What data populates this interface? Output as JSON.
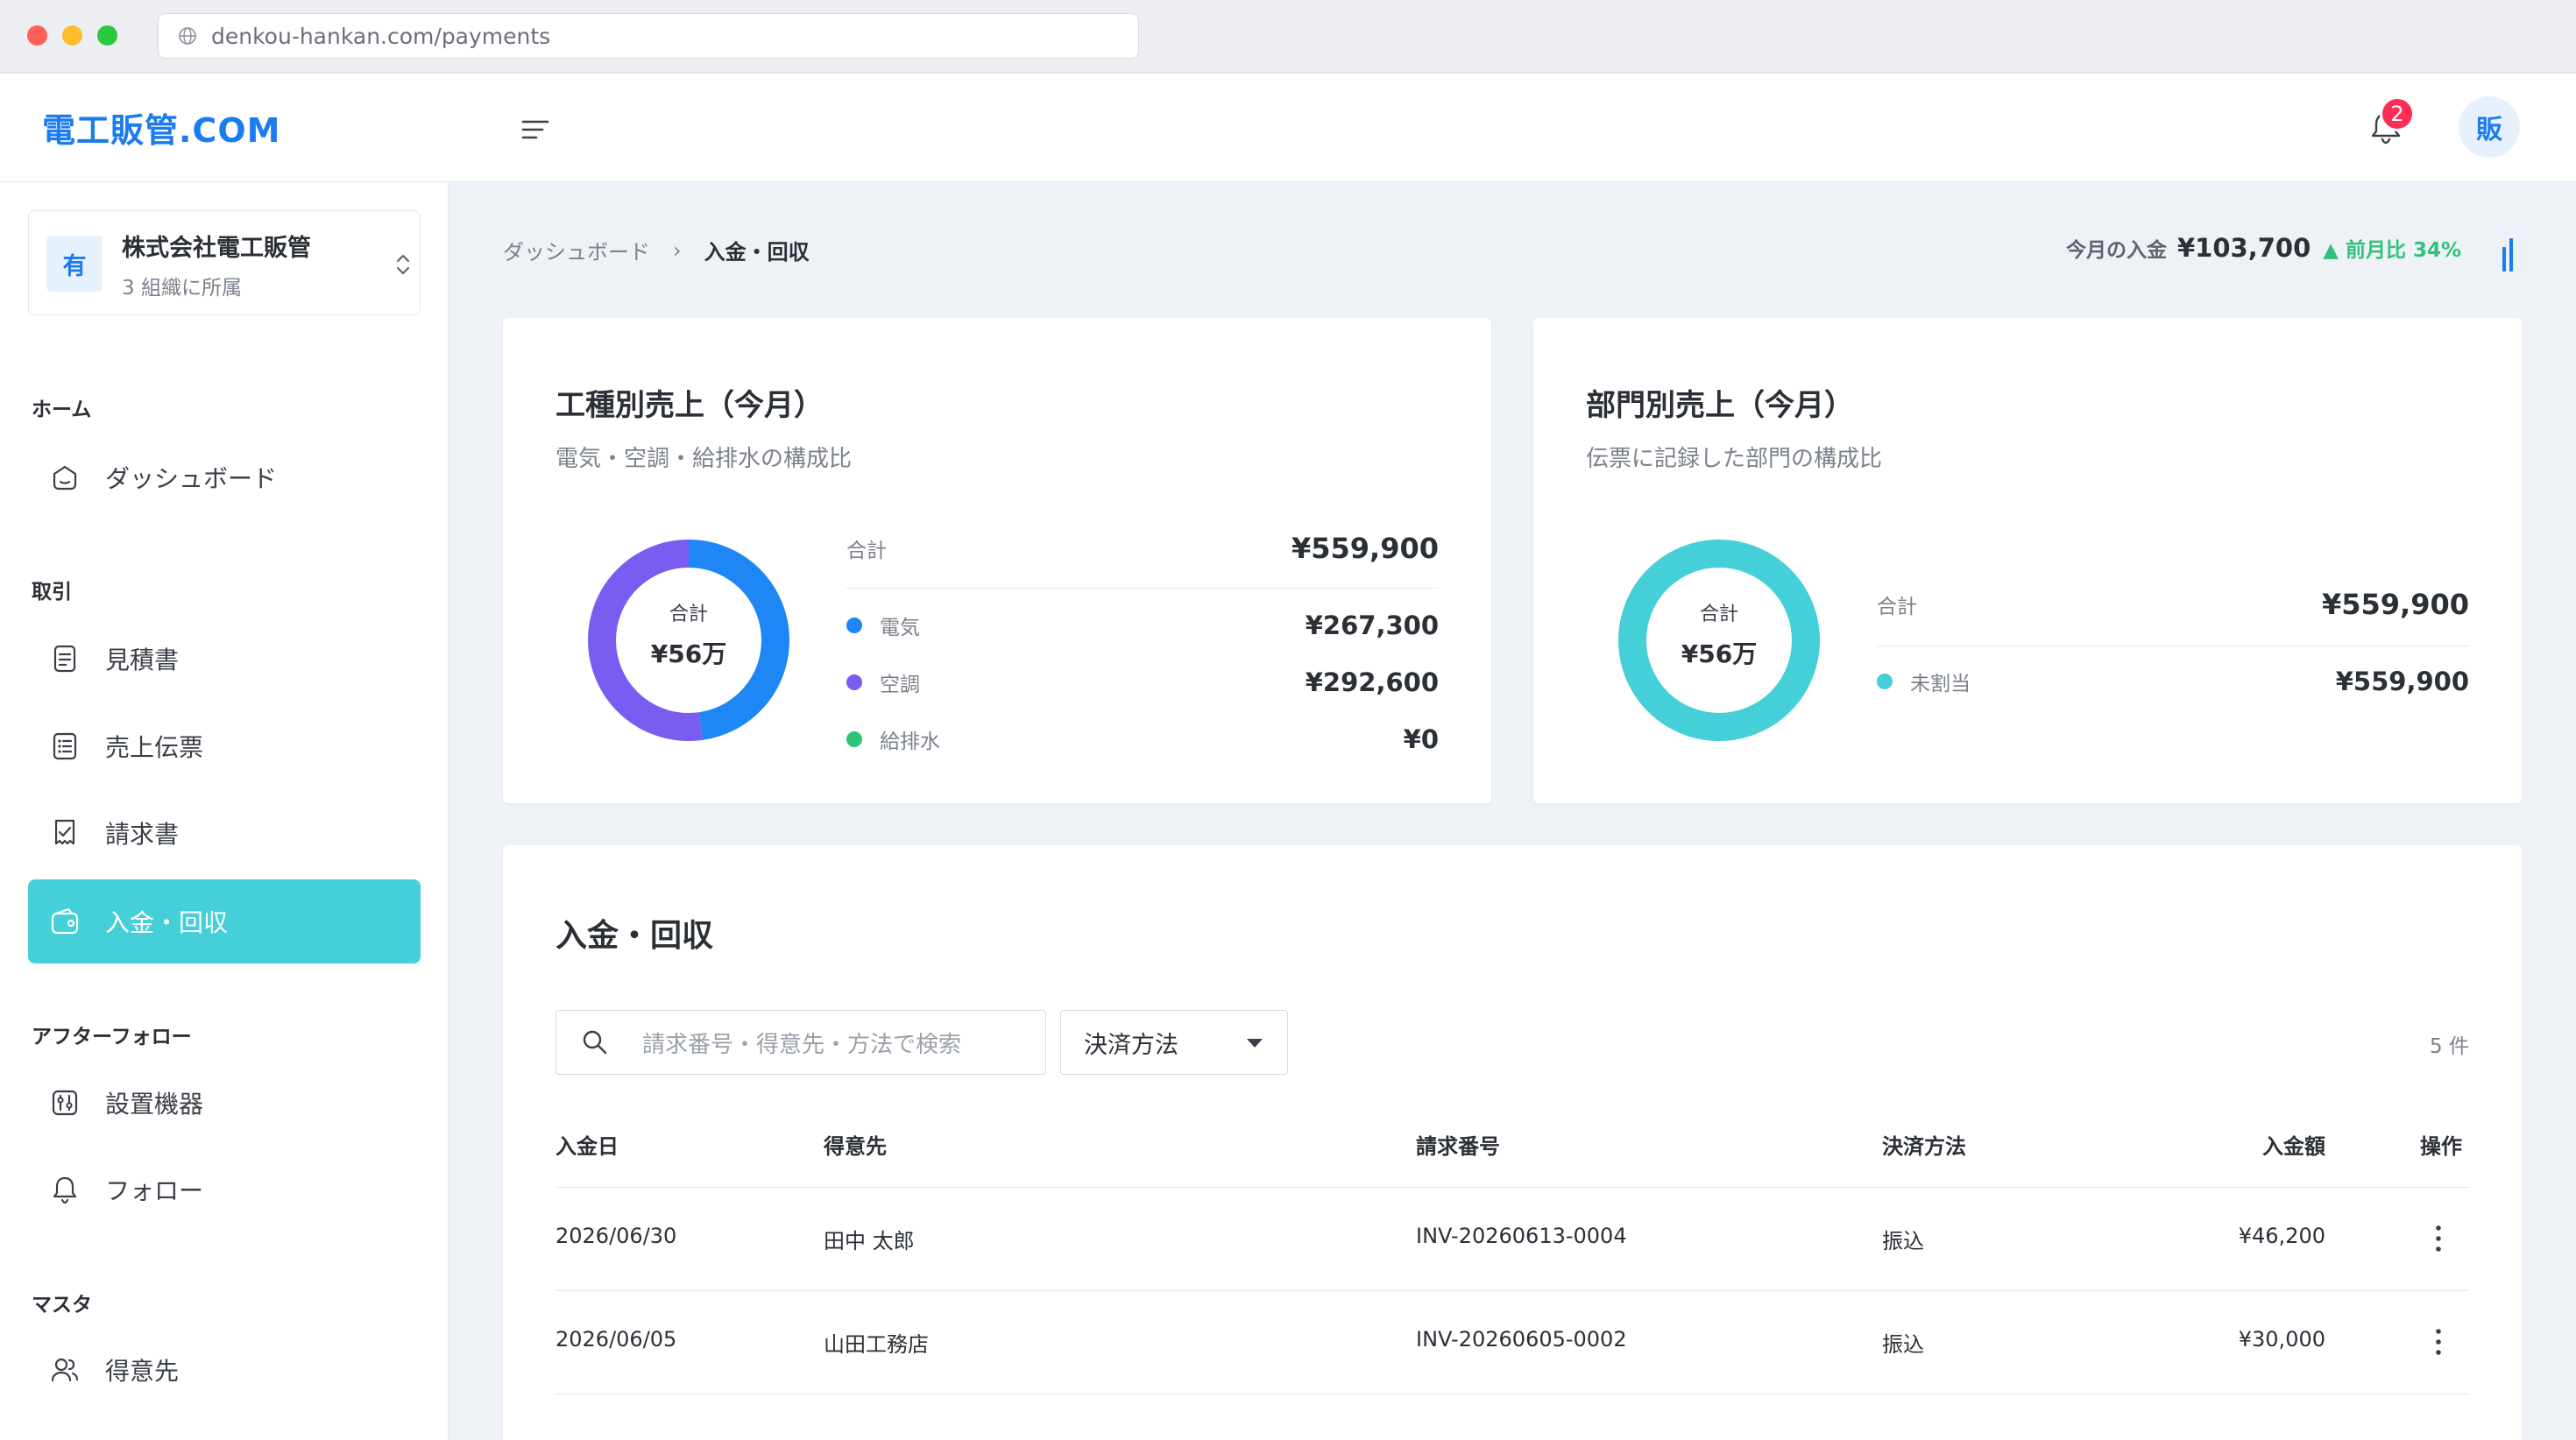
{
  "browser": {
    "url": "denkou-hankan.com/payments"
  },
  "header": {
    "logo": "電工販管.COM",
    "notification_count": "2",
    "avatar_initial": "販"
  },
  "sidebar": {
    "org": {
      "icon_initial": "有",
      "name": "株式会社電工販管",
      "sub": "3 組織に所属"
    },
    "sections": [
      {
        "label": "ホーム",
        "items": [
          {
            "label": "ダッシュボード",
            "icon": "dashboard-icon"
          }
        ]
      },
      {
        "label": "取引",
        "items": [
          {
            "label": "見積書",
            "icon": "document-icon"
          },
          {
            "label": "売上伝票",
            "icon": "list-icon"
          },
          {
            "label": "請求書",
            "icon": "invoice-icon"
          },
          {
            "label": "入金・回収",
            "icon": "wallet-icon",
            "active": true
          }
        ]
      },
      {
        "label": "アフターフォロー",
        "items": [
          {
            "label": "設置機器",
            "icon": "device-icon"
          },
          {
            "label": "フォロー",
            "icon": "bell-icon"
          }
        ]
      },
      {
        "label": "マスタ",
        "items": [
          {
            "label": "得意先",
            "icon": "users-icon"
          }
        ]
      }
    ]
  },
  "breadcrumb": {
    "home": "ダッシュボード",
    "current": "入金・回収"
  },
  "today_summary": {
    "label": "今月の入金",
    "amount": "¥103,700",
    "delta": "▲ 前月比 34%"
  },
  "trade_card": {
    "title": "工種別売上（今月）",
    "subtitle": "電気・空調・給排水の構成比",
    "center_caption": "合計",
    "center_value": "¥56万",
    "total_label": "合計",
    "total_value": "¥559,900",
    "items": [
      {
        "label": "電気",
        "value": "¥267,300",
        "color": "#1f86f5",
        "amount": 267300
      },
      {
        "label": "空調",
        "value": "¥292,600",
        "color": "#7b5cf0",
        "amount": 292600
      },
      {
        "label": "給排水",
        "value": "¥0",
        "color": "#2fc27a",
        "amount": 0
      }
    ]
  },
  "dept_card": {
    "title": "部門別売上（今月）",
    "subtitle": "伝票に記録した部門の構成比",
    "center_caption": "合計",
    "center_value": "¥56万",
    "total_label": "合計",
    "total_value": "¥559,900",
    "items": [
      {
        "label": "未割当",
        "value": "¥559,900",
        "color": "#45cfd8",
        "amount": 559900
      }
    ]
  },
  "payments": {
    "title": "入金・回収",
    "search_placeholder": "請求番号・得意先・方法で検索",
    "filter_label": "決済方法",
    "count": "5 件",
    "columns": [
      "入金日",
      "得意先",
      "請求番号",
      "決済方法",
      "入金額",
      "操作"
    ],
    "rows": [
      {
        "date": "2026/06/30",
        "customer": "田中 太郎",
        "invoice": "INV-20260613-0004",
        "method": "振込",
        "amount": "¥46,200"
      },
      {
        "date": "2026/06/05",
        "customer": "山田工務店",
        "invoice": "INV-20260605-0002",
        "method": "振込",
        "amount": "¥30,000"
      }
    ]
  },
  "colors": {
    "brand": "#1b7cf0",
    "accent": "#45cfd8",
    "positive": "#2fc27a",
    "alert": "#ff2d55"
  }
}
